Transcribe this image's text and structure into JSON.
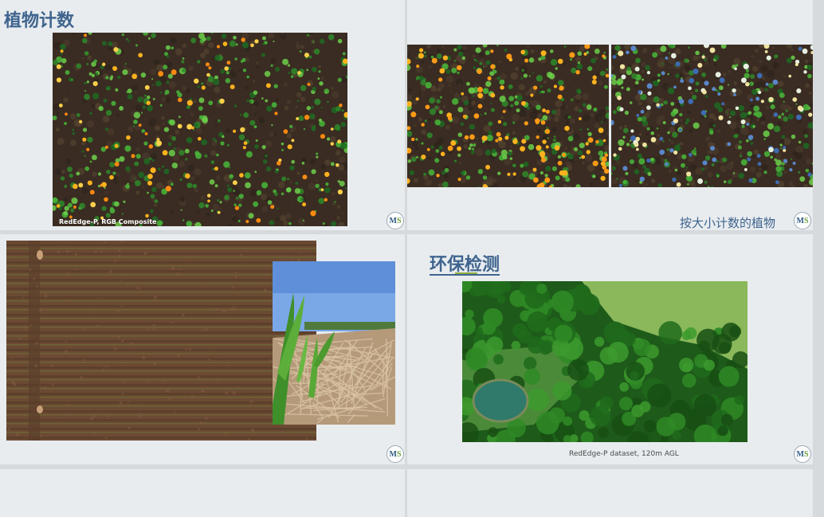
{
  "slides": [
    {
      "title": "植物计数",
      "caption": "RedEdge-P, RGB Composite",
      "logo": {
        "letters": "M",
        "accent_letter": "S"
      }
    },
    {
      "caption": "按大小计数的植物",
      "logo": {
        "letters": "M",
        "accent_letter": "S"
      }
    },
    {
      "logo": {
        "letters": "M",
        "accent_letter": "S"
      }
    },
    {
      "title": "环保检测",
      "caption": "RedEdge-P dataset, 120m AGL",
      "logo": {
        "letters": "M",
        "accent_letter": "S"
      }
    }
  ],
  "colors": {
    "title": "#3f648e",
    "slide_background": "#e8ecef",
    "title_underline_accent": "#8fae3e"
  }
}
